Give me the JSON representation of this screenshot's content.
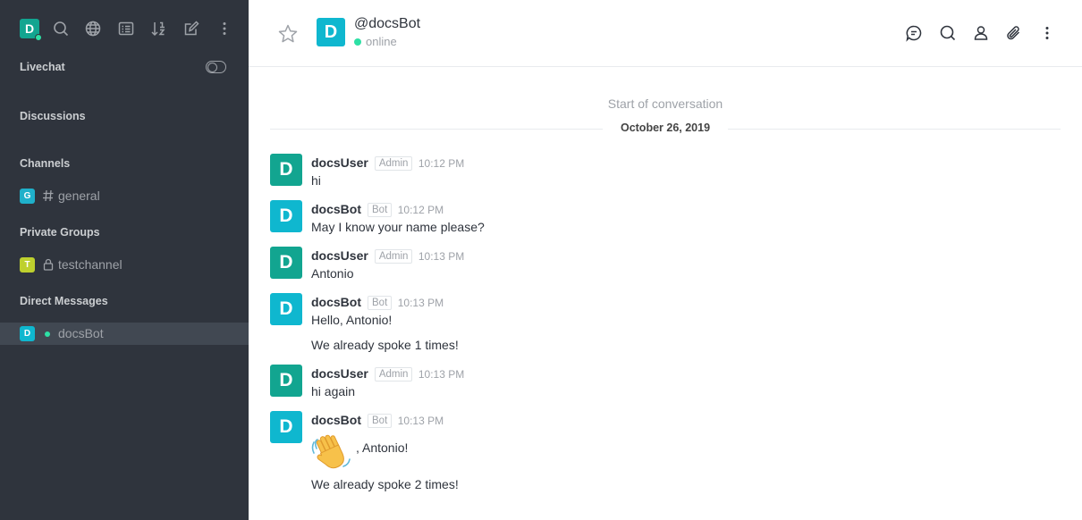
{
  "user": {
    "initial": "D",
    "color": "#12a590"
  },
  "toolbar": {
    "icons": [
      "search-icon",
      "globe-icon",
      "directory-icon",
      "sort-icon",
      "edit-icon",
      "kebab-icon"
    ]
  },
  "sidebar": {
    "livechat_label": "Livechat",
    "discussions_label": "Discussions",
    "channels_label": "Channels",
    "channels": [
      {
        "initial": "G",
        "name": "general",
        "color": "#1fb0ca"
      }
    ],
    "private_groups_label": "Private Groups",
    "private_groups": [
      {
        "initial": "T",
        "name": "testchannel",
        "color": "#bed02e"
      }
    ],
    "direct_messages_label": "Direct Messages",
    "direct_messages": [
      {
        "initial": "D",
        "name": "docsBot",
        "color": "#0fb7cf",
        "status": "online"
      }
    ]
  },
  "header": {
    "initial": "D",
    "at": "@",
    "name": "docsBot",
    "status": "online"
  },
  "conversation": {
    "start_label": "Start of conversation",
    "date": "October 26, 2019"
  },
  "colors": {
    "user_avatar": "#12a590",
    "bot_avatar": "#0fb7cf",
    "online": "#2de0a5",
    "sidebar_bg": "#2f343d"
  },
  "messages": [
    {
      "initial": "D",
      "name": "docsUser",
      "role": "Admin",
      "time": "10:12 PM",
      "lines": [
        "hi"
      ]
    },
    {
      "initial": "D",
      "name": "docsBot",
      "role": "Bot",
      "time": "10:12 PM",
      "lines": [
        "May I know your name please?"
      ]
    },
    {
      "initial": "D",
      "name": "docsUser",
      "role": "Admin",
      "time": "10:13 PM",
      "lines": [
        "Antonio"
      ]
    },
    {
      "initial": "D",
      "name": "docsBot",
      "role": "Bot",
      "time": "10:13 PM",
      "lines": [
        "Hello, Antonio!",
        "We already spoke 1 times!"
      ]
    },
    {
      "initial": "D",
      "name": "docsUser",
      "role": "Admin",
      "time": "10:13 PM",
      "lines": [
        "hi again"
      ]
    },
    {
      "initial": "D",
      "name": "docsBot",
      "role": "Bot",
      "time": "10:13 PM",
      "emoji": "waving-hand-emoji",
      "lines": [
        ", Antonio!",
        "We already spoke 2 times!"
      ]
    }
  ]
}
